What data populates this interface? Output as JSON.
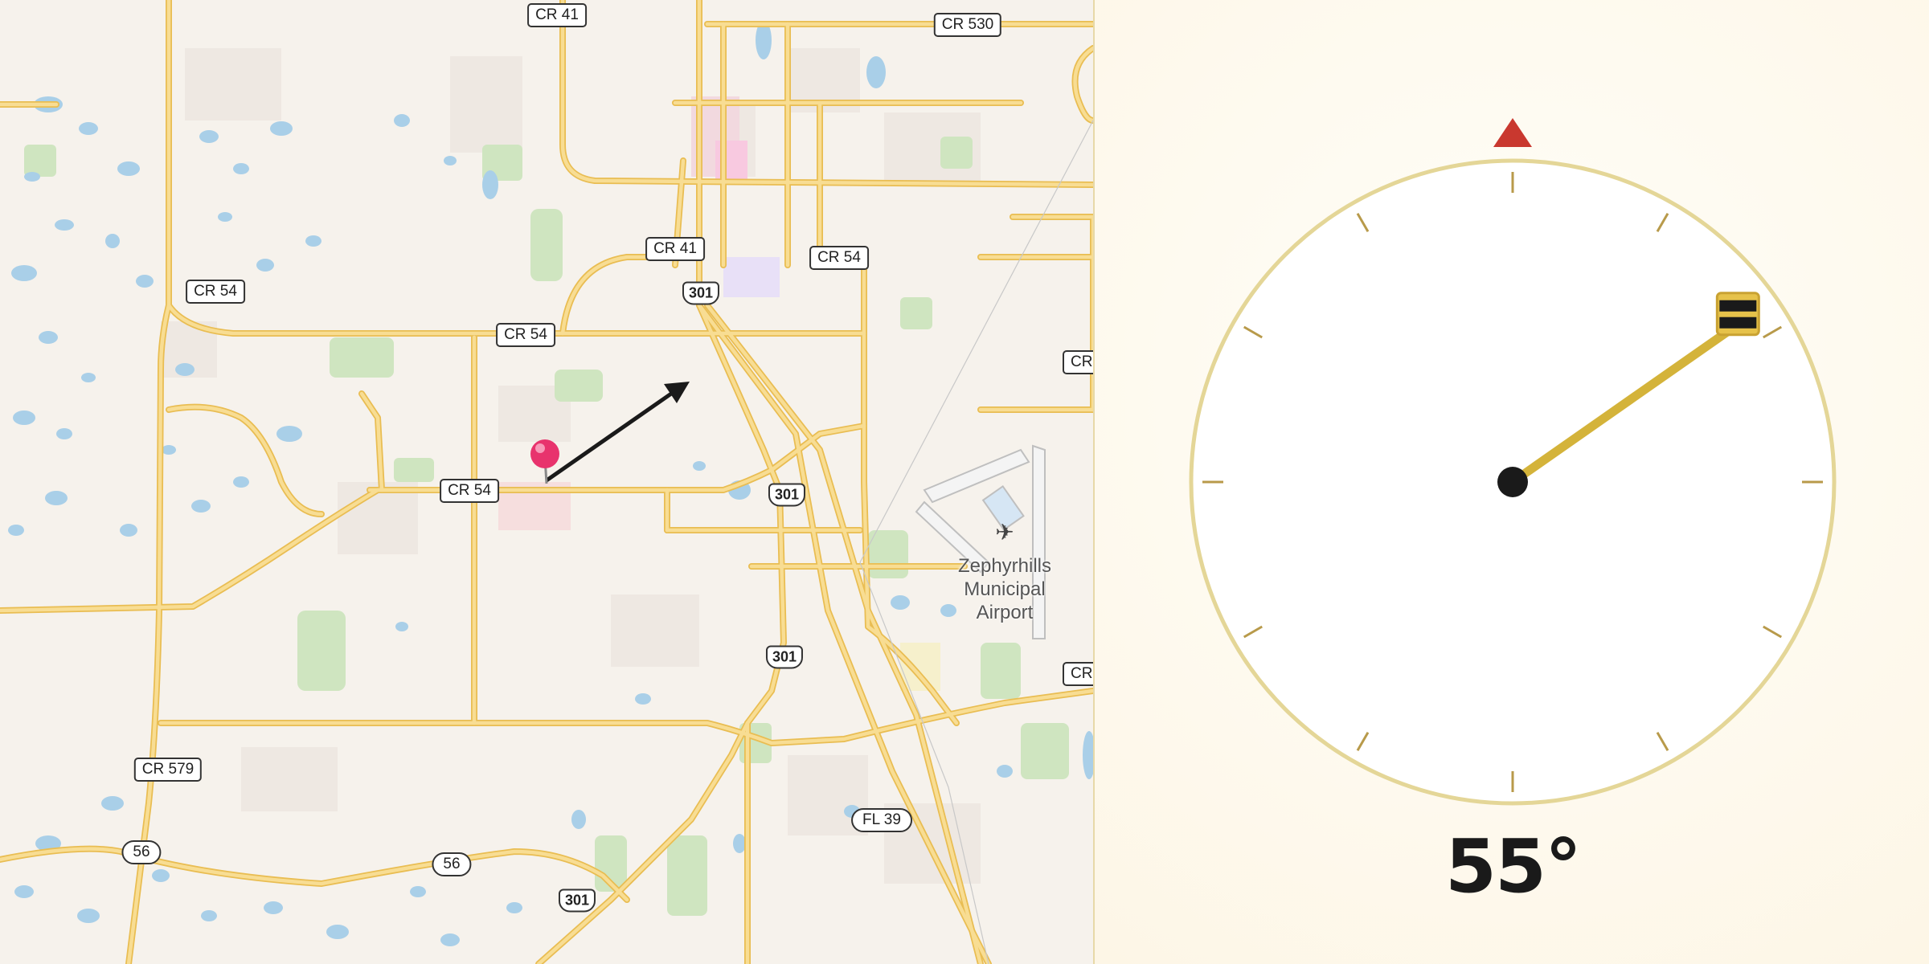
{
  "map": {
    "road_labels": [
      {
        "id": "cr41-top",
        "text": "CR 41",
        "type": "rect"
      },
      {
        "id": "cr530",
        "text": "CR 530",
        "type": "rect"
      },
      {
        "id": "cr41-mid",
        "text": "CR 41",
        "type": "rect"
      },
      {
        "id": "cr54-east",
        "text": "CR 54",
        "type": "rect"
      },
      {
        "id": "cr54-west",
        "text": "CR 54",
        "type": "rect"
      },
      {
        "id": "cr54-mid",
        "text": "CR 54",
        "type": "rect"
      },
      {
        "id": "cr54-main",
        "text": "CR 54",
        "type": "rect"
      },
      {
        "id": "us301-a",
        "text": "301",
        "type": "us"
      },
      {
        "id": "us301-b",
        "text": "301",
        "type": "us"
      },
      {
        "id": "us301-c",
        "text": "301",
        "type": "us"
      },
      {
        "id": "us301-d",
        "text": "301",
        "type": "us"
      },
      {
        "id": "cr579",
        "text": "CR 579",
        "type": "rect"
      },
      {
        "id": "fl39",
        "text": "FL 39",
        "type": "oval"
      },
      {
        "id": "sr56-a",
        "text": "56",
        "type": "oval"
      },
      {
        "id": "sr56-b",
        "text": "56",
        "type": "oval"
      },
      {
        "id": "cr-edge-a",
        "text": "CR",
        "type": "clip"
      },
      {
        "id": "cr-edge-b",
        "text": "CR",
        "type": "clip"
      }
    ],
    "airport_name_line1": "Zephyrhills",
    "airport_name_line2": "Municipal Airport",
    "marker_icon": "map-pin-icon",
    "colors": {
      "road": "#f5d47a",
      "road_casing": "#e9bd52",
      "water": "#a9cfe8",
      "park": "#cfe5c0",
      "land": "#f6f2ec",
      "pin": "#e8336d",
      "arrow": "#1a1a1a"
    }
  },
  "compass": {
    "heading_degrees": 55,
    "heading_text": "55°",
    "north_marker_icon": "north-triangle-icon",
    "needle_knob_icon": "needle-knob-icon",
    "colors": {
      "ring": "#e4d697",
      "needle": "#d4b33a",
      "north_marker": "#c9382f",
      "hub": "#1a1a1a",
      "ticks": "#b89a4a"
    }
  }
}
